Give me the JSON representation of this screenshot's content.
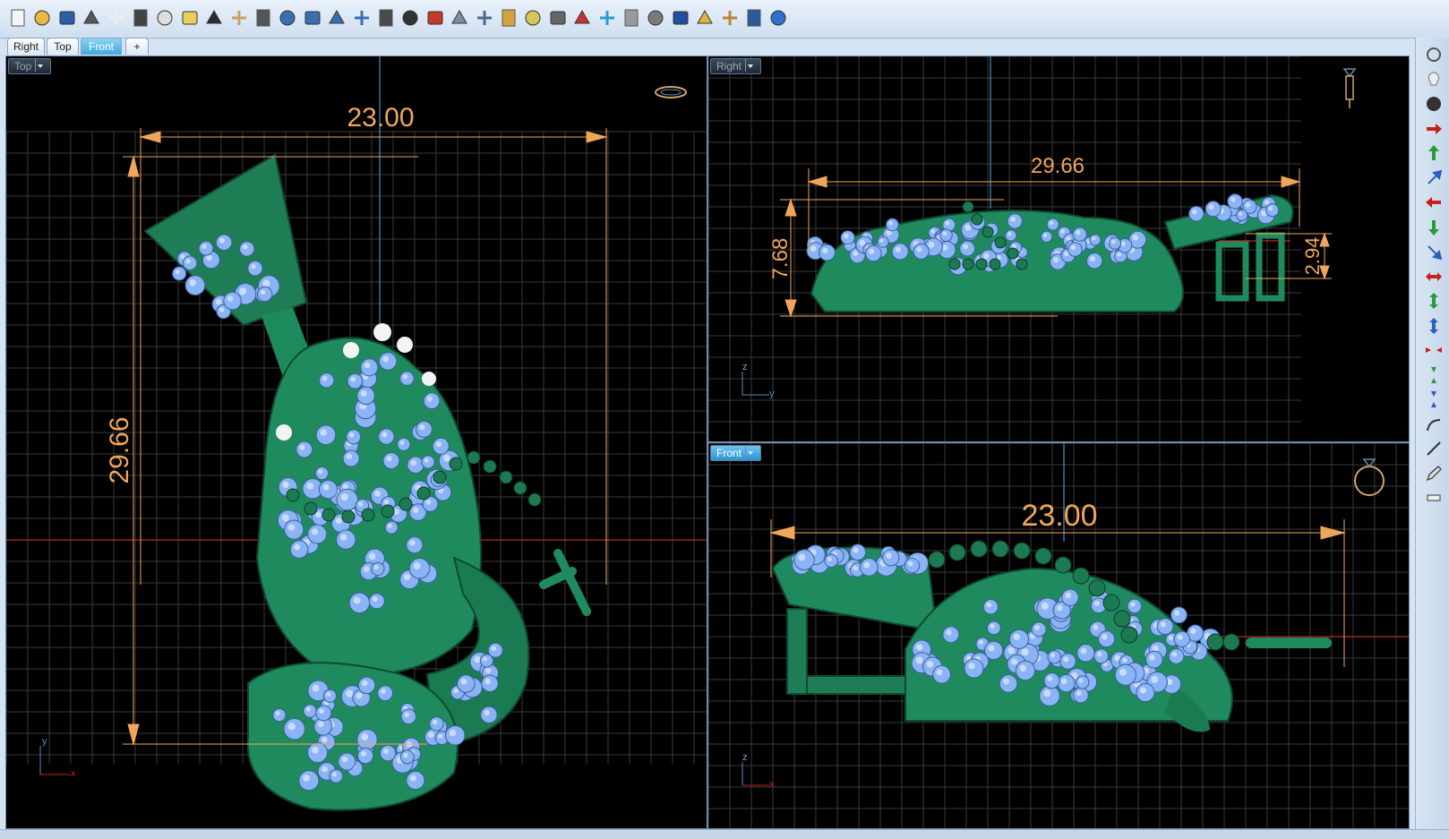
{
  "toolbar": {
    "icons": [
      "new-file-icon",
      "open-folder-icon",
      "save-icon",
      "print-icon",
      "import-icon",
      "cut-icon",
      "copy-icon",
      "paste-icon",
      "undo-icon",
      "pan-hand-icon",
      "move-icon",
      "zoom-icon",
      "zoom-window-icon",
      "zoom-extents-icon",
      "zoom-selected-icon",
      "rotate-view-icon",
      "four-viewports-icon",
      "car-icon",
      "layers-icon",
      "history-icon",
      "snap-icon",
      "light-bulb-icon",
      "lock-icon",
      "materials-icon",
      "color-wheel-icon",
      "shaded-sphere-icon",
      "rendered-sphere-icon",
      "environment-sphere-icon",
      "render-icon",
      "options-gear-icon",
      "dimension-icon",
      "help-icon"
    ]
  },
  "tabs": [
    {
      "label": "Right"
    },
    {
      "label": "Top"
    },
    {
      "label": "Front"
    },
    {
      "label": "+"
    }
  ],
  "viewports": {
    "top": {
      "label": "Top",
      "dim_h": "23.00",
      "dim_v": "29.66",
      "axis_a": "y",
      "axis_b": "x"
    },
    "right": {
      "label": "Right",
      "dim_h": "29.66",
      "dim_v": "7.68",
      "dim_v2": "2.94",
      "axis_a": "z",
      "axis_b": "y"
    },
    "front": {
      "label": "Front",
      "dim_h": "23.00",
      "axis_a": "z",
      "axis_b": "x"
    }
  },
  "sidebar": {
    "icons": [
      "rotate-view-icon",
      "light-bulb-icon",
      "shaded-sphere-icon",
      "move-right-icon",
      "move-up-icon",
      "move-up-right-icon",
      "move-left-icon",
      "move-down-icon",
      "move-down-right-icon",
      "scale-horizontal-icon",
      "scale-vertical-icon",
      "scale-vertical-blue-icon",
      "shrink-horizontal-icon",
      "shrink-vertical-icon",
      "shrink-vertical-blue-icon",
      "bend-icon",
      "line-icon",
      "pencil-icon",
      "measure-icon"
    ]
  },
  "colors": {
    "model": "#1f8a5e",
    "gem": "#8ab4f5",
    "dimension": "#f0a65a",
    "grid": "#3a3a3a",
    "axis_red": "#c0271c",
    "axis_blue": "#4d90b8"
  }
}
